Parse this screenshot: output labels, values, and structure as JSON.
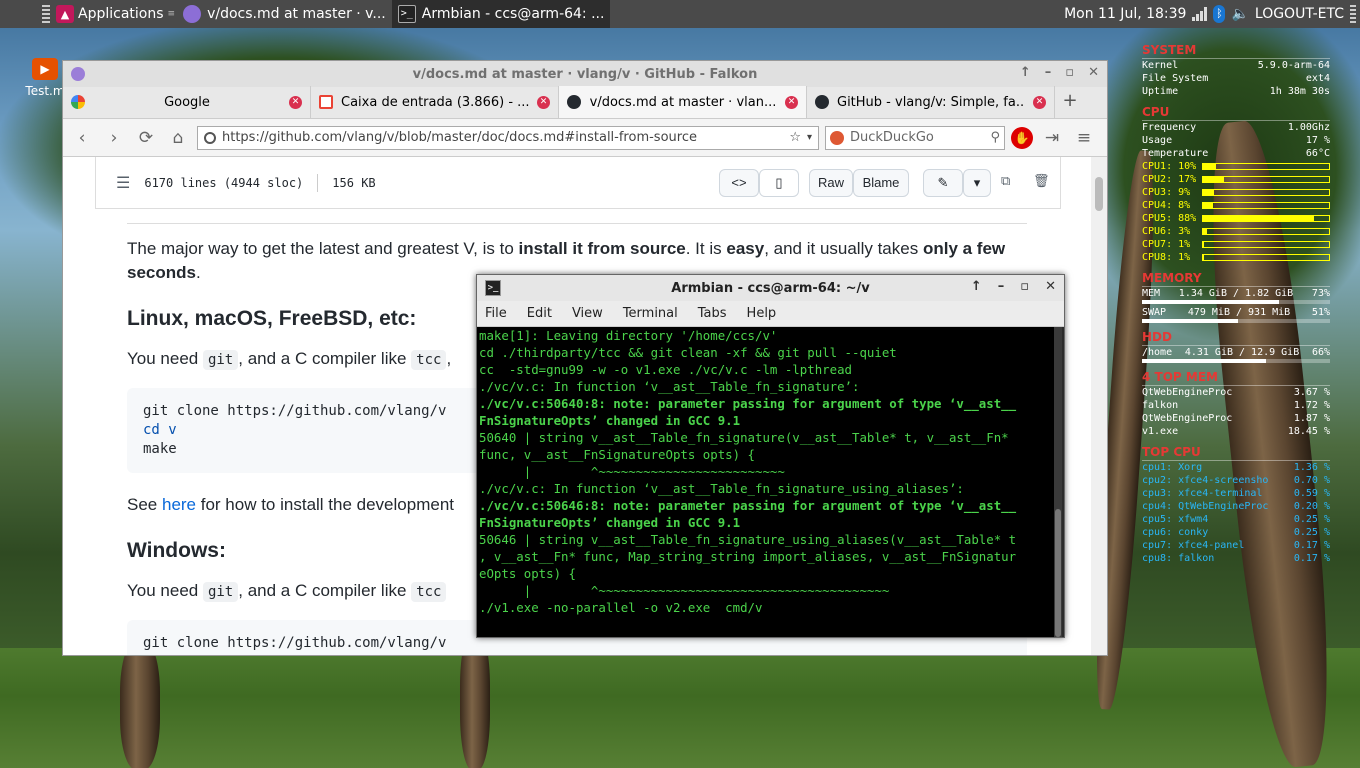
{
  "panel": {
    "applications": "Applications",
    "tasks": [
      {
        "label": "v/docs.md at master · v..."
      },
      {
        "label": "Armbian - ccs@arm-64: ..."
      }
    ],
    "clock": "Mon 11 Jul, 18:39",
    "session": "LOGOUT-ETC"
  },
  "desktop": {
    "icon_label": "Test.m"
  },
  "browser": {
    "window_title": "v/docs.md at master · vlang/v · GitHub - Falkon",
    "tabs": [
      {
        "label": "Google",
        "icon": "google-icon",
        "color": "#4285f4"
      },
      {
        "label": "Caixa de entrada (3.866) - ...",
        "icon": "gmail-icon",
        "color": "#ea4335"
      },
      {
        "label": "v/docs.md at master · vlan...",
        "icon": "github-icon",
        "color": "#24292f"
      },
      {
        "label": "GitHub - vlang/v: Simple, fa...",
        "icon": "github-icon",
        "color": "#24292f"
      }
    ],
    "url": "https://github.com/vlang/v/blob/master/doc/docs.md#install-from-source",
    "search_placeholder": "DuckDuckGo"
  },
  "github": {
    "lines": "6170 lines (4944 sloc)",
    "size": "156 KB",
    "raw": "Raw",
    "blame": "Blame",
    "intro_a": "The major way to get the latest and greatest V, is to ",
    "intro_b": "install it from source",
    "intro_c": ". It is ",
    "intro_d": "easy",
    "intro_e": ", and it usually takes ",
    "intro_f": "only a few seconds",
    "intro_g": ".",
    "h_linux": "Linux, macOS, FreeBSD, etc:",
    "need_a": "You need ",
    "need_git": "git",
    "need_b": ", and a C compiler like ",
    "need_tcc": "tcc",
    "need_c": ", ",
    "code1": [
      "git clone https://github.com/vlang/v",
      "cd v",
      "make"
    ],
    "see_a": "See ",
    "see_link": "here",
    "see_b": " for how to install the development",
    "h_windows": "Windows:",
    "need2_a": "You need ",
    "need2_git": "git",
    "need2_b": ", and a C compiler like ",
    "need2_tcc": "tcc",
    "code2": "git clone https://github.com/vlang/v"
  },
  "terminal": {
    "title": "Armbian - ccs@arm-64: ~/v",
    "menu": [
      "File",
      "Edit",
      "View",
      "Terminal",
      "Tabs",
      "Help"
    ],
    "lines": [
      "make[1]: Leaving directory '/home/ccs/v'",
      "cd ./thirdparty/tcc && git clean -xf && git pull --quiet",
      "cc  -std=gnu99 -w -o v1.exe ./vc/v.c -lm -lpthread",
      "./vc/v.c: In function ‘v__ast__Table_fn_signature’:",
      "./vc/v.c:50640:8: note: parameter passing for argument of type ‘v__ast__",
      "FnSignatureOpts’ changed in GCC 9.1",
      "50640 | string v__ast__Table_fn_signature(v__ast__Table* t, v__ast__Fn*",
      "func, v__ast__FnSignatureOpts opts) {",
      "      |        ^~~~~~~~~~~~~~~~~~~~~~~~~~",
      "./vc/v.c: In function ‘v__ast__Table_fn_signature_using_aliases’:",
      "./vc/v.c:50646:8: note: parameter passing for argument of type ‘v__ast__",
      "FnSignatureOpts’ changed in GCC 9.1",
      "50646 | string v__ast__Table_fn_signature_using_aliases(v__ast__Table* t",
      ", v__ast__Fn* func, Map_string_string import_aliases, v__ast__FnSignatur",
      "eOpts opts) {",
      "      |        ^~~~~~~~~~~~~~~~~~~~~~~~~~~~~~~~~~~~~~~~",
      "./v1.exe -no-parallel -o v2.exe  cmd/v"
    ]
  },
  "conky": {
    "system": {
      "title": "SYSTEM",
      "rows": [
        [
          "Kernel",
          "5.9.0-arm-64"
        ],
        [
          "File System",
          "ext4"
        ],
        [
          "Uptime",
          "1h 38m 30s"
        ]
      ]
    },
    "cpu": {
      "title": "CPU",
      "rows": [
        [
          "Frequency",
          "1.00Ghz"
        ],
        [
          "Usage",
          "17 %"
        ],
        [
          "Temperature",
          "66°C"
        ]
      ],
      "cores": [
        {
          "label": "CPU1: 10%",
          "pct": 10
        },
        {
          "label": "CPU2: 17%",
          "pct": 17
        },
        {
          "label": "CPU3: 9%",
          "pct": 9
        },
        {
          "label": "CPU4: 8%",
          "pct": 8
        },
        {
          "label": "CPU5: 88%",
          "pct": 88
        },
        {
          "label": "CPU6: 3%",
          "pct": 3
        },
        {
          "label": "CPU7: 1%",
          "pct": 1
        },
        {
          "label": "CPU8: 1%",
          "pct": 1
        }
      ]
    },
    "memory": {
      "title": "MEMORY",
      "mem": [
        "MEM",
        "1.34 GiB / 1.82 GiB",
        "73%"
      ],
      "mem_pct": 73,
      "swap": [
        "SWAP",
        "479 MiB / 931 MiB",
        "51%"
      ],
      "swap_pct": 51
    },
    "hdd": {
      "title": "HDD",
      "row": [
        "/home",
        "4.31 GiB / 12.9 GiB",
        "66%"
      ],
      "pct": 66
    },
    "topmem": {
      "title": "4 TOP MEM",
      "rows": [
        [
          "QtWebEngineProc",
          "3.67 %"
        ],
        [
          "falkon",
          "1.72 %"
        ],
        [
          "QtWebEngineProc",
          "1.87 %"
        ],
        [
          "v1.exe",
          "18.45 %"
        ]
      ]
    },
    "topcpu": {
      "title": "TOP CPU",
      "rows": [
        [
          "cpu1: Xorg",
          "1.36 %"
        ],
        [
          "cpu2: xfce4-screensho",
          "0.70 %"
        ],
        [
          "cpu3: xfce4-terminal",
          "0.59 %"
        ],
        [
          "cpu4: QtWebEngineProc",
          "0.20 %"
        ],
        [
          "cpu5: xfwm4",
          "0.25 %"
        ],
        [
          "cpu6: conky",
          "0.25 %"
        ],
        [
          "cpu7: xfce4-panel",
          "0.17 %"
        ],
        [
          "cpu8: falkon",
          "0.17 %"
        ]
      ]
    }
  }
}
